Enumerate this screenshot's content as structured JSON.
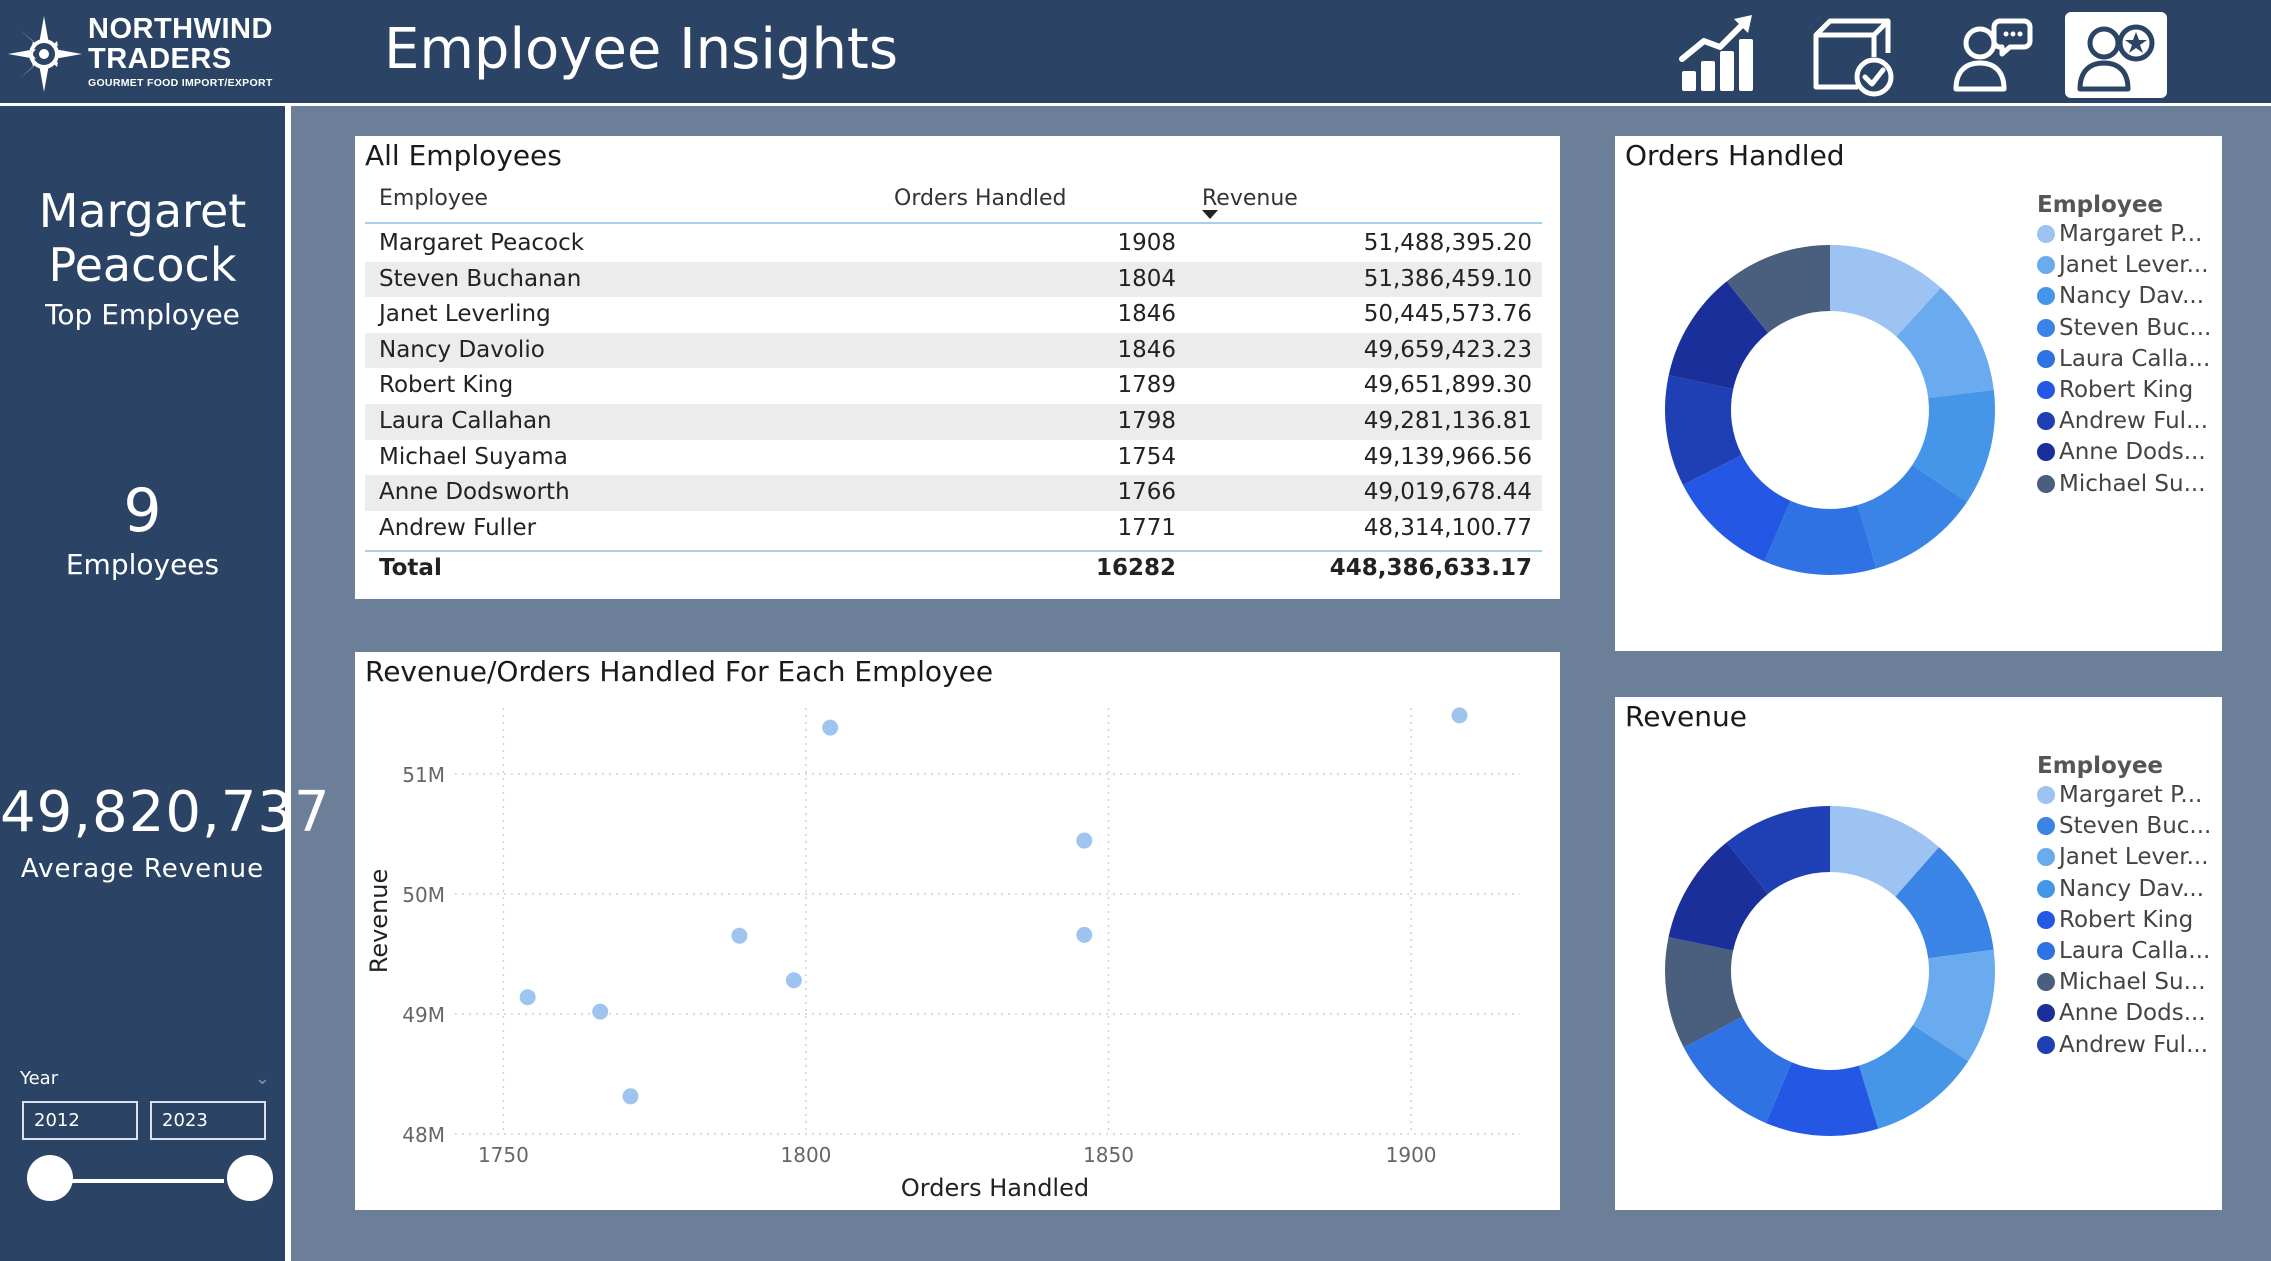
{
  "brand": {
    "line1": "NORTHWIND",
    "line2": "TRADERS",
    "line3": "GOURMET FOOD IMPORT/EXPORT"
  },
  "header": {
    "title": "Employee Insights",
    "nav": [
      {
        "icon": "sales-chart-icon",
        "active": false
      },
      {
        "icon": "product-box-icon",
        "active": false
      },
      {
        "icon": "customers-chat-icon",
        "active": false
      },
      {
        "icon": "employee-star-icon",
        "active": true
      }
    ]
  },
  "sidebar": {
    "top_employee_name": "Margaret Peacock",
    "top_employee_label": "Top Employee",
    "employee_count": "9",
    "employee_count_label": "Employees",
    "average_revenue": "49,820,737",
    "average_revenue_label": "Average Revenue",
    "year_slicer": {
      "title": "Year",
      "min": "2012",
      "max": "2023"
    }
  },
  "table": {
    "title": "All Employees",
    "headers": {
      "employee": "Employee",
      "orders": "Orders Handled",
      "revenue": "Revenue"
    },
    "rows": [
      {
        "employee": "Margaret Peacock",
        "orders": "1908",
        "revenue": "51,488,395.20"
      },
      {
        "employee": "Steven Buchanan",
        "orders": "1804",
        "revenue": "51,386,459.10"
      },
      {
        "employee": "Janet Leverling",
        "orders": "1846",
        "revenue": "50,445,573.76"
      },
      {
        "employee": "Nancy Davolio",
        "orders": "1846",
        "revenue": "49,659,423.23"
      },
      {
        "employee": "Robert King",
        "orders": "1789",
        "revenue": "49,651,899.30"
      },
      {
        "employee": "Laura Callahan",
        "orders": "1798",
        "revenue": "49,281,136.81"
      },
      {
        "employee": "Michael Suyama",
        "orders": "1754",
        "revenue": "49,139,966.56"
      },
      {
        "employee": "Anne Dodsworth",
        "orders": "1766",
        "revenue": "49,019,678.44"
      },
      {
        "employee": "Andrew Fuller",
        "orders": "1771",
        "revenue": "48,314,100.77"
      }
    ],
    "total": {
      "label": "Total",
      "orders": "16282",
      "revenue": "448,386,633.17"
    }
  },
  "colors": {
    "header_bg": "#2b4465",
    "page_bg": "#6b7f99",
    "scatter_point": "#9dc5ef"
  },
  "chart_data": [
    {
      "type": "scatter",
      "title": "Revenue/Orders Handled For Each Employee",
      "xlabel": "Orders Handled",
      "ylabel": "Revenue",
      "xlim": [
        1742,
        1918
      ],
      "ylim": [
        48000000,
        51550000
      ],
      "xticks": [
        1750,
        1800,
        1850,
        1900
      ],
      "xtick_labels": [
        "1750",
        "1800",
        "1850",
        "1900"
      ],
      "yticks": [
        48000000,
        49000000,
        50000000,
        51000000
      ],
      "ytick_labels": [
        "48M",
        "49M",
        "50M",
        "51M"
      ],
      "grid": true,
      "points": [
        {
          "x": 1908,
          "y": 51488395.2
        },
        {
          "x": 1804,
          "y": 51386459.1
        },
        {
          "x": 1846,
          "y": 50445573.76
        },
        {
          "x": 1846,
          "y": 49659423.23
        },
        {
          "x": 1789,
          "y": 49651899.3
        },
        {
          "x": 1798,
          "y": 49281136.81
        },
        {
          "x": 1754,
          "y": 49139966.56
        },
        {
          "x": 1766,
          "y": 49019678.44
        },
        {
          "x": 1771,
          "y": 48314100.77
        }
      ]
    },
    {
      "type": "pie",
      "title": "Orders Handled",
      "legend_title": "Employee",
      "legend_position": "right",
      "donut": true,
      "slices": [
        {
          "label": "Margaret P...",
          "value": 1908,
          "color": "#9cc3f2"
        },
        {
          "label": "Janet Lever...",
          "value": 1846,
          "color": "#6aaaee"
        },
        {
          "label": "Nancy Dav...",
          "value": 1846,
          "color": "#4596e8"
        },
        {
          "label": "Steven Buc...",
          "value": 1804,
          "color": "#3a84e6"
        },
        {
          "label": "Laura Calla...",
          "value": 1798,
          "color": "#2f72e3"
        },
        {
          "label": "Robert King",
          "value": 1789,
          "color": "#2457e4"
        },
        {
          "label": "Andrew Ful...",
          "value": 1771,
          "color": "#1e40b4"
        },
        {
          "label": "Anne Dods...",
          "value": 1766,
          "color": "#1a2f99"
        },
        {
          "label": "Michael Su...",
          "value": 1754,
          "color": "#4a5f7e"
        }
      ]
    },
    {
      "type": "pie",
      "title": "Revenue",
      "legend_title": "Employee",
      "legend_position": "right",
      "donut": true,
      "slices": [
        {
          "label": "Margaret P...",
          "value": 51488395.2,
          "color": "#9cc3f2"
        },
        {
          "label": "Steven Buc...",
          "value": 51386459.1,
          "color": "#3a84e6"
        },
        {
          "label": "Janet Lever...",
          "value": 50445573.76,
          "color": "#6aaaee"
        },
        {
          "label": "Nancy Dav...",
          "value": 49659423.23,
          "color": "#4596e8"
        },
        {
          "label": "Robert King",
          "value": 49651899.3,
          "color": "#2457e4"
        },
        {
          "label": "Laura Calla...",
          "value": 49281136.81,
          "color": "#2f72e3"
        },
        {
          "label": "Michael Su...",
          "value": 49139966.56,
          "color": "#4a5f7e"
        },
        {
          "label": "Anne Dods...",
          "value": 49019678.44,
          "color": "#1a2f99"
        },
        {
          "label": "Andrew Ful...",
          "value": 48314100.77,
          "color": "#1e40b4"
        }
      ]
    }
  ]
}
